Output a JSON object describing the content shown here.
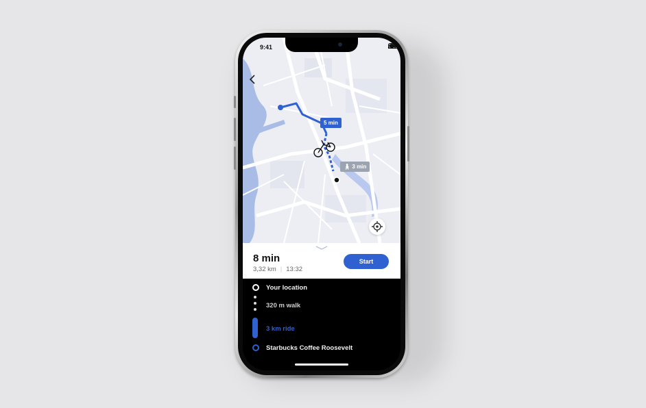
{
  "status_bar": {
    "time": "9:41"
  },
  "map": {
    "walk_badge": "5 min",
    "walk_badge_icon": "walk-icon",
    "foot_badge": "3 min",
    "foot_badge_icon": "pedestrian-icon",
    "route_color": "#2f62d0",
    "river_color": "#a9bce6"
  },
  "trip": {
    "duration": "8 min",
    "distance": "3,32 km",
    "arrival": "13:32",
    "start_label": "Start"
  },
  "itinerary": {
    "steps": [
      {
        "label": "Your location"
      },
      {
        "label": "320 m walk"
      },
      {
        "label": "3 km ride"
      },
      {
        "label": "Starbucks Coffee Roosevelt"
      }
    ]
  },
  "colors": {
    "accent": "#2f62d0",
    "background": "#e6e6e8",
    "panel": "#000000"
  }
}
